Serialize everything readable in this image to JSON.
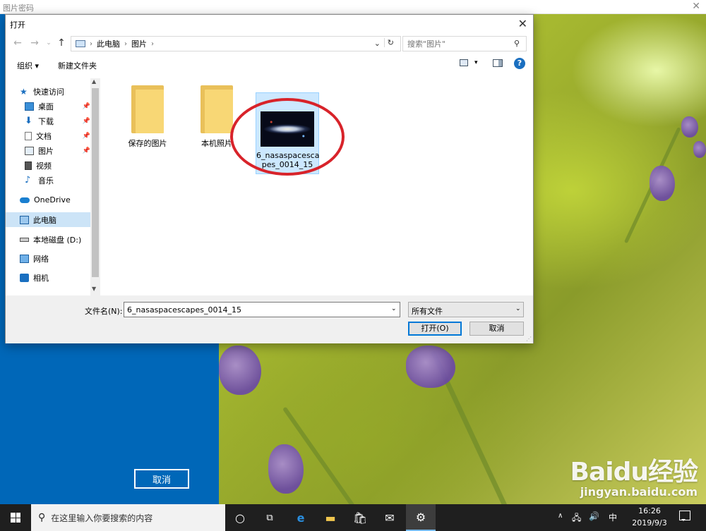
{
  "background": {
    "title": "图片密码",
    "cancel_label": "取消"
  },
  "dialog": {
    "title": "打开",
    "breadcrumb": [
      "此电脑",
      "图片"
    ],
    "search_placeholder": "搜索\"图片\"",
    "toolbar": {
      "organize_label": "组织 ▾",
      "new_folder_label": "新建文件夹"
    },
    "sidebar": {
      "items": [
        {
          "label": "快速访问",
          "icon": "star-icon",
          "pinned": false
        },
        {
          "label": "桌面",
          "icon": "desktop-icon",
          "pinned": true
        },
        {
          "label": "下载",
          "icon": "download-icon",
          "pinned": true
        },
        {
          "label": "文档",
          "icon": "document-icon",
          "pinned": true
        },
        {
          "label": "图片",
          "icon": "pictures-icon",
          "pinned": true
        },
        {
          "label": "视频",
          "icon": "video-icon",
          "pinned": false
        },
        {
          "label": "音乐",
          "icon": "music-icon",
          "pinned": false
        },
        {
          "label": "OneDrive",
          "icon": "cloud-icon",
          "pinned": false
        },
        {
          "label": "此电脑",
          "icon": "computer-icon",
          "pinned": false
        },
        {
          "label": "本地磁盘 (D:)",
          "icon": "drive-icon",
          "pinned": false
        },
        {
          "label": "网络",
          "icon": "network-icon",
          "pinned": false
        },
        {
          "label": "相机",
          "icon": "camera-icon",
          "pinned": false
        }
      ]
    },
    "files": [
      {
        "name": "保存的图片",
        "type": "folder"
      },
      {
        "name": "本机照片",
        "type": "folder"
      },
      {
        "name": "6_nasaspacescapes_0014_15",
        "type": "image",
        "display_lines": [
          "6_nasaspacesca",
          "pes_0014_15"
        ]
      }
    ],
    "filename_label": "文件名(N):",
    "filename_value": "6_nasaspacescapes_0014_15",
    "filetype_value": "所有文件",
    "open_label": "打开(O)",
    "cancel_label": "取消"
  },
  "taskbar": {
    "search_placeholder": "在这里输入你要搜索的内容",
    "ime": "中",
    "time": "16:26",
    "date": "2019/9/3"
  },
  "watermark": {
    "logo": "Baidu经验",
    "url": "jingyan.baidu.com"
  },
  "colors": {
    "accent": "#0078d7",
    "highlight_circle": "#d8232a",
    "background_blue": "#0067b8"
  }
}
